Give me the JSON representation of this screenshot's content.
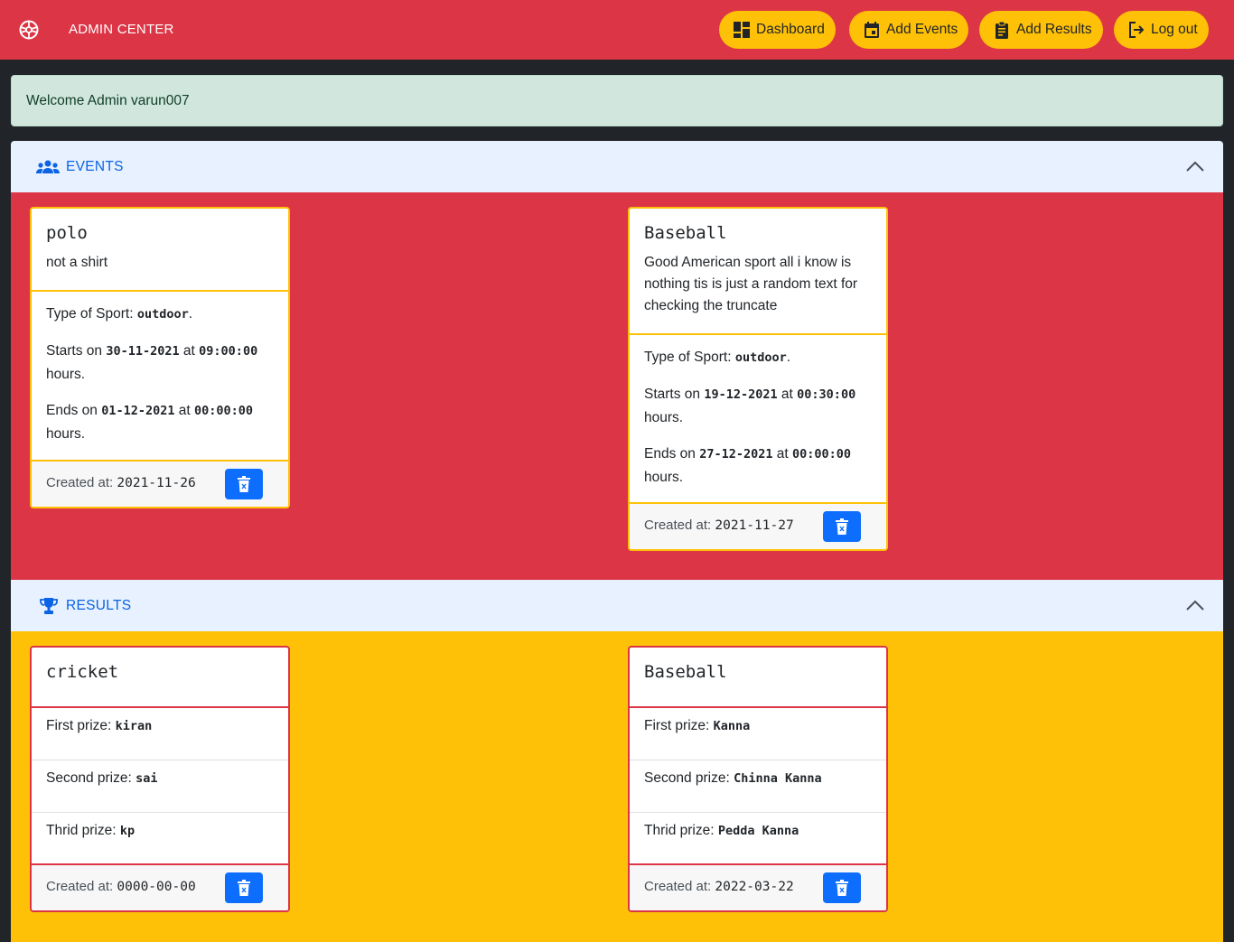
{
  "navbar": {
    "brand": "ADMIN CENTER",
    "buttons": [
      {
        "label": "Dashboard",
        "icon": "dashboard-icon"
      },
      {
        "label": "Add Events",
        "icon": "calendar-icon"
      },
      {
        "label": "Add Results",
        "icon": "clipboard-icon"
      },
      {
        "label": "Log out",
        "icon": "logout-icon"
      }
    ]
  },
  "welcome": "Welcome Admin varun007",
  "events": {
    "header": "EVENTS",
    "cards": [
      {
        "title": "polo",
        "description": "not a shirt",
        "type_label": "Type of Sport: ",
        "type": "outdoor",
        "starts_label": "Starts on ",
        "start_date": "30-11-2021",
        "at": " at ",
        "start_time": "09:00:00",
        "ends_label": "Ends on ",
        "end_date": "01-12-2021",
        "end_time": "00:00:00",
        "hours": "hours.",
        "created_label": "Created at: ",
        "created": "2021-11-26"
      },
      {
        "title": "Baseball",
        "description": "Good American sport all i know is nothing tis is just a random text for checking the truncate",
        "type_label": "Type of Sport: ",
        "type": "outdoor",
        "starts_label": "Starts on ",
        "start_date": "19-12-2021",
        "at": " at ",
        "start_time": "00:30:00",
        "ends_label": "Ends on ",
        "end_date": "27-12-2021",
        "end_time": "00:00:00",
        "hours": "hours.",
        "created_label": "Created at: ",
        "created": "2021-11-27"
      }
    ]
  },
  "results": {
    "header": "RESULTS",
    "cards": [
      {
        "title": "cricket",
        "first_label": "First prize: ",
        "first": "kiran",
        "second_label": "Second prize: ",
        "second": "sai",
        "third_label": "Thrid prize: ",
        "third": "kp",
        "created_label": "Created at: ",
        "created": "0000-00-00"
      },
      {
        "title": "Baseball",
        "first_label": "First prize: ",
        "first": "Kanna",
        "second_label": "Second prize: ",
        "second": "Chinna Kanna",
        "third_label": "Thrid prize: ",
        "third": "Pedda Kanna",
        "created_label": "Created at: ",
        "created": "2022-03-22"
      }
    ]
  },
  "colors": {
    "navbar": "#dc3545",
    "nav_button": "#ffc107",
    "welcome_bg": "#d1e7dd",
    "accordion_header": "#e7f1ff",
    "events_body": "#dc3545",
    "results_body": "#ffc107",
    "delete_button": "#0d6efd"
  }
}
